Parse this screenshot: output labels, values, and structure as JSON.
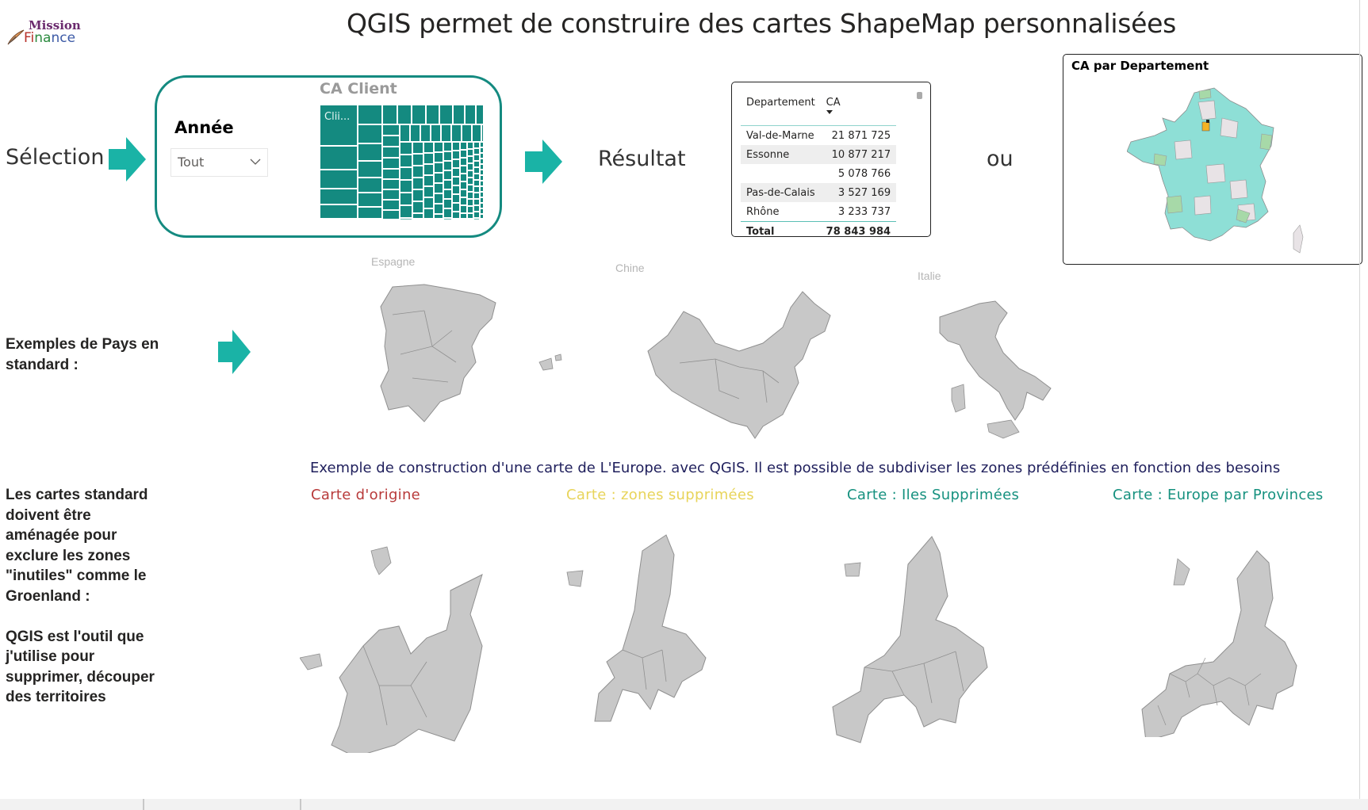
{
  "header": {
    "logo_line1": "Mission",
    "logo_line2_f": "Fi",
    "logo_line2_n": "na",
    "logo_line2_rest": "nce",
    "title": "QGIS permet de construire des cartes ShapeMap personnalisées"
  },
  "flow": {
    "selection_label": "Sélection",
    "resultat_label": "Résultat",
    "ou_label": "ou",
    "arrow_color": "#1AB3A6"
  },
  "slicer": {
    "label": "Année",
    "selected_value": "Tout"
  },
  "treemap": {
    "title": "CA Client",
    "first_tile_label": "Clii...",
    "color": "#148A80"
  },
  "table": {
    "columns": [
      "Departement",
      "CA"
    ],
    "rows": [
      {
        "departement": "Val-de-Marne",
        "ca": "21 871 725"
      },
      {
        "departement": "Essonne",
        "ca": "10 877 217"
      },
      {
        "departement": "",
        "ca": "5 078 766"
      },
      {
        "departement": "Pas-de-Calais",
        "ca": "3 527 169"
      },
      {
        "departement": "Rhône",
        "ca": "3 233 737"
      }
    ],
    "total_label": "Total",
    "total_value": "78 843 984"
  },
  "france_map": {
    "title": "CA par Departement",
    "colors": {
      "low": "#E8E3E6",
      "mid": "#8EDFD6",
      "green": "#A7D9A8",
      "highlight": "#F5B324"
    }
  },
  "countries": {
    "intro": "Exemples de Pays en standard :",
    "labels": [
      "Espagne",
      "Chine",
      "Italie"
    ]
  },
  "europe": {
    "description": "Exemple de construction d'une carte de L'Europe. avec QGIS. Il est possible de subdiviser les zones prédéfinies en fonction des besoins",
    "left_text_lines": [
      "Les cartes standard",
      "doivent être",
      "aménagée pour",
      "exclure les zones",
      "\"inutiles\" comme le",
      "Groenland :",
      "",
      "QGIS est l'outil que",
      "j'utilise pour",
      "supprimer, découper",
      "des territoires"
    ],
    "maps": [
      {
        "title": "Carte d'origine",
        "color": "#B83A3A"
      },
      {
        "title": "Carte : zones supprimées",
        "color": "#E8D45A"
      },
      {
        "title": "Carte : Iles Supprimées",
        "color": "#16917F"
      },
      {
        "title": "Carte : Europe par Provinces",
        "color": "#16917F"
      }
    ]
  }
}
